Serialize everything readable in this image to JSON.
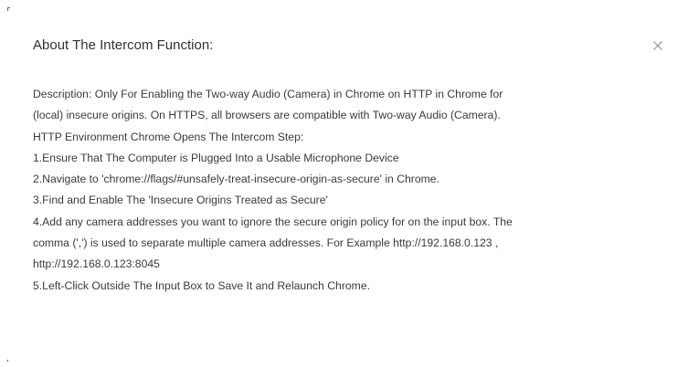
{
  "dialog": {
    "title": "About The Intercom Function:",
    "close_glyph": "×",
    "close_icon": "close-icon",
    "lines": [
      "Description: Only For Enabling the Two-way Audio (Camera) in Chrome on HTTP in Chrome for",
      "(local) insecure origins. On HTTPS, all browsers are compatible with Two-way Audio (Camera).",
      "HTTP Environment Chrome Opens The Intercom Step:",
      "1.Ensure That The Computer is Plugged Into a Usable Microphone Device",
      "2.Navigate to 'chrome://flags/#unsafely-treat-insecure-origin-as-secure' in Chrome.",
      "3.Find and Enable The 'Insecure Origins Treated as Secure'",
      "4.Add any camera addresses you want to ignore the secure origin policy for on the input box. The",
      "comma (',') is used to separate multiple camera addresses. For Example http://192.168.0.123 ,",
      "http://192.168.0.123:8045",
      "5.Left-Click Outside The Input Box to Save It and Relaunch Chrome."
    ]
  }
}
